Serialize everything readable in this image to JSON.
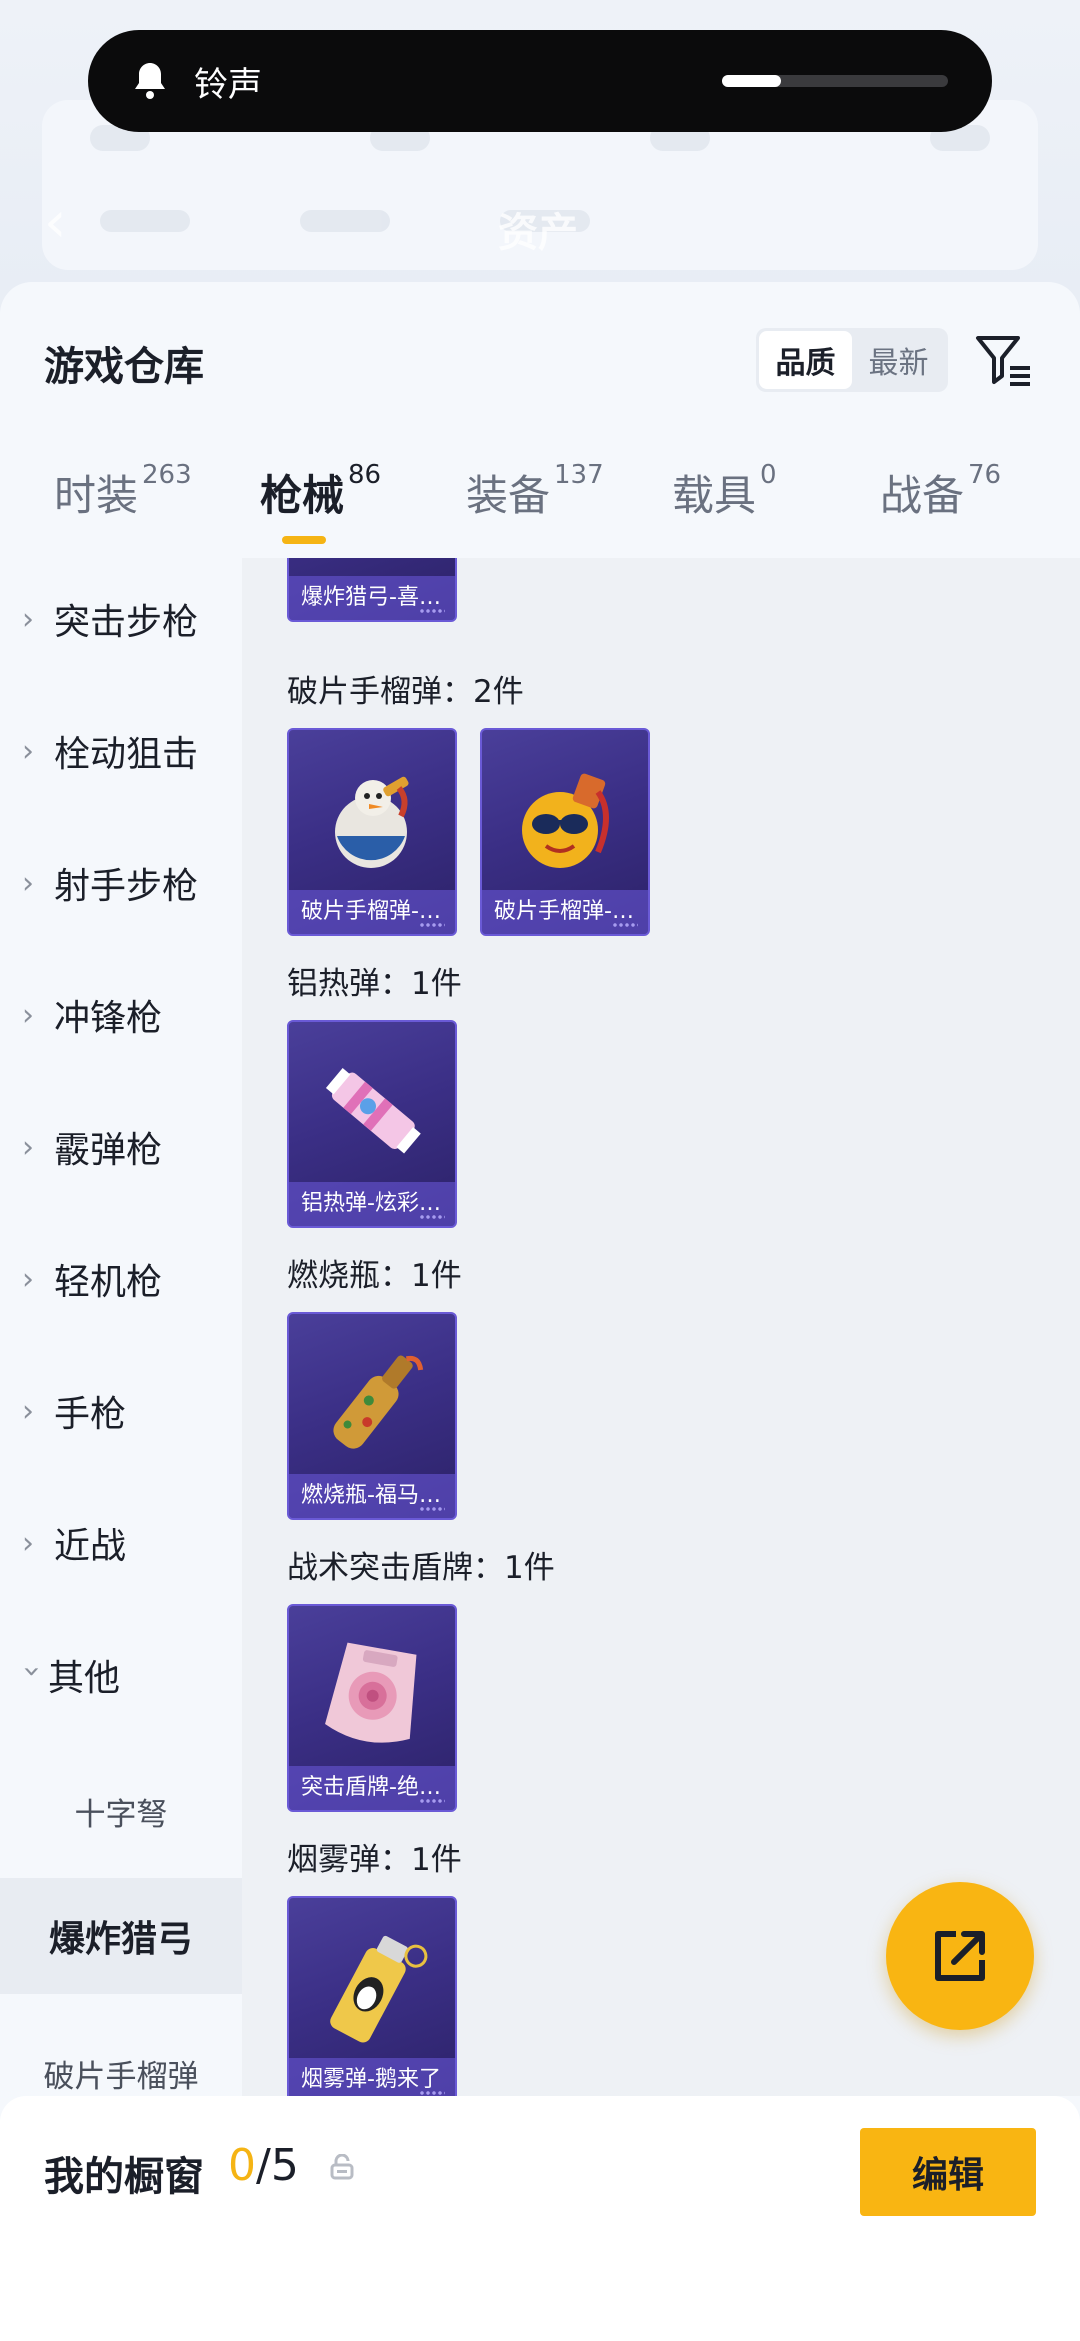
{
  "status_overlay": {
    "label": "铃声",
    "volume_level": 0.26
  },
  "background_header": {
    "title": "资产",
    "back_icon": "chevron-left-icon"
  },
  "sheet": {
    "title": "游戏仓库",
    "sort_options": [
      {
        "label": "品质",
        "active": true
      },
      {
        "label": "最新",
        "active": false
      }
    ],
    "filter_icon": "filter-icon"
  },
  "tabs": [
    {
      "label": "时装",
      "count": "263",
      "active": false
    },
    {
      "label": "枪械",
      "count": "86",
      "active": true
    },
    {
      "label": "装备",
      "count": "137",
      "active": false
    },
    {
      "label": "载具",
      "count": "0",
      "active": false
    },
    {
      "label": "战备",
      "count": "76",
      "active": false
    }
  ],
  "sidebar": {
    "categories": [
      {
        "label": "突击步枪",
        "expanded": false
      },
      {
        "label": "栓动狙击",
        "expanded": false
      },
      {
        "label": "射手步枪",
        "expanded": false
      },
      {
        "label": "冲锋枪",
        "expanded": false
      },
      {
        "label": "霰弹枪",
        "expanded": false
      },
      {
        "label": "轻机枪",
        "expanded": false
      },
      {
        "label": "手枪",
        "expanded": false
      },
      {
        "label": "近战",
        "expanded": false
      },
      {
        "label": "其他",
        "expanded": true
      }
    ],
    "subcategories": [
      {
        "label": "十字弩",
        "selected": false
      },
      {
        "label": "爆炸猎弓",
        "selected": true
      },
      {
        "label": "破片手榴弹",
        "selected": false
      }
    ]
  },
  "content": {
    "top_item": {
      "label": "爆炸猎弓-喜…"
    },
    "groups": [
      {
        "title": "破片手榴弹：2件",
        "items": [
          {
            "label": "破片手榴弹-…",
            "art": "snowman-grenade"
          },
          {
            "label": "破片手榴弹-…",
            "art": "sunglasses-grenade"
          }
        ]
      },
      {
        "title": "铝热弹：1件",
        "items": [
          {
            "label": "铝热弹-炫彩…",
            "art": "candy-thermite"
          }
        ]
      },
      {
        "title": "燃烧瓶：1件",
        "items": [
          {
            "label": "燃烧瓶-福马…",
            "art": "molotov-bottle"
          }
        ]
      },
      {
        "title": "战术突击盾牌：1件",
        "items": [
          {
            "label": "突击盾牌-绝…",
            "art": "rose-shield"
          }
        ]
      },
      {
        "title": "烟雾弹：1件",
        "items": [
          {
            "label": "烟雾弹-鹅来了",
            "art": "penguin-smoke"
          }
        ]
      }
    ]
  },
  "fab": {
    "icon": "share-external-icon"
  },
  "bottom_bar": {
    "label": "我的橱窗",
    "current": "0",
    "total": "/5",
    "lock_icon": "lock-icon",
    "edit_label": "编辑"
  },
  "colors": {
    "accent": "#f9b512",
    "card_bg": "#3b2f86",
    "sheet_bg": "#f5f8fc"
  }
}
